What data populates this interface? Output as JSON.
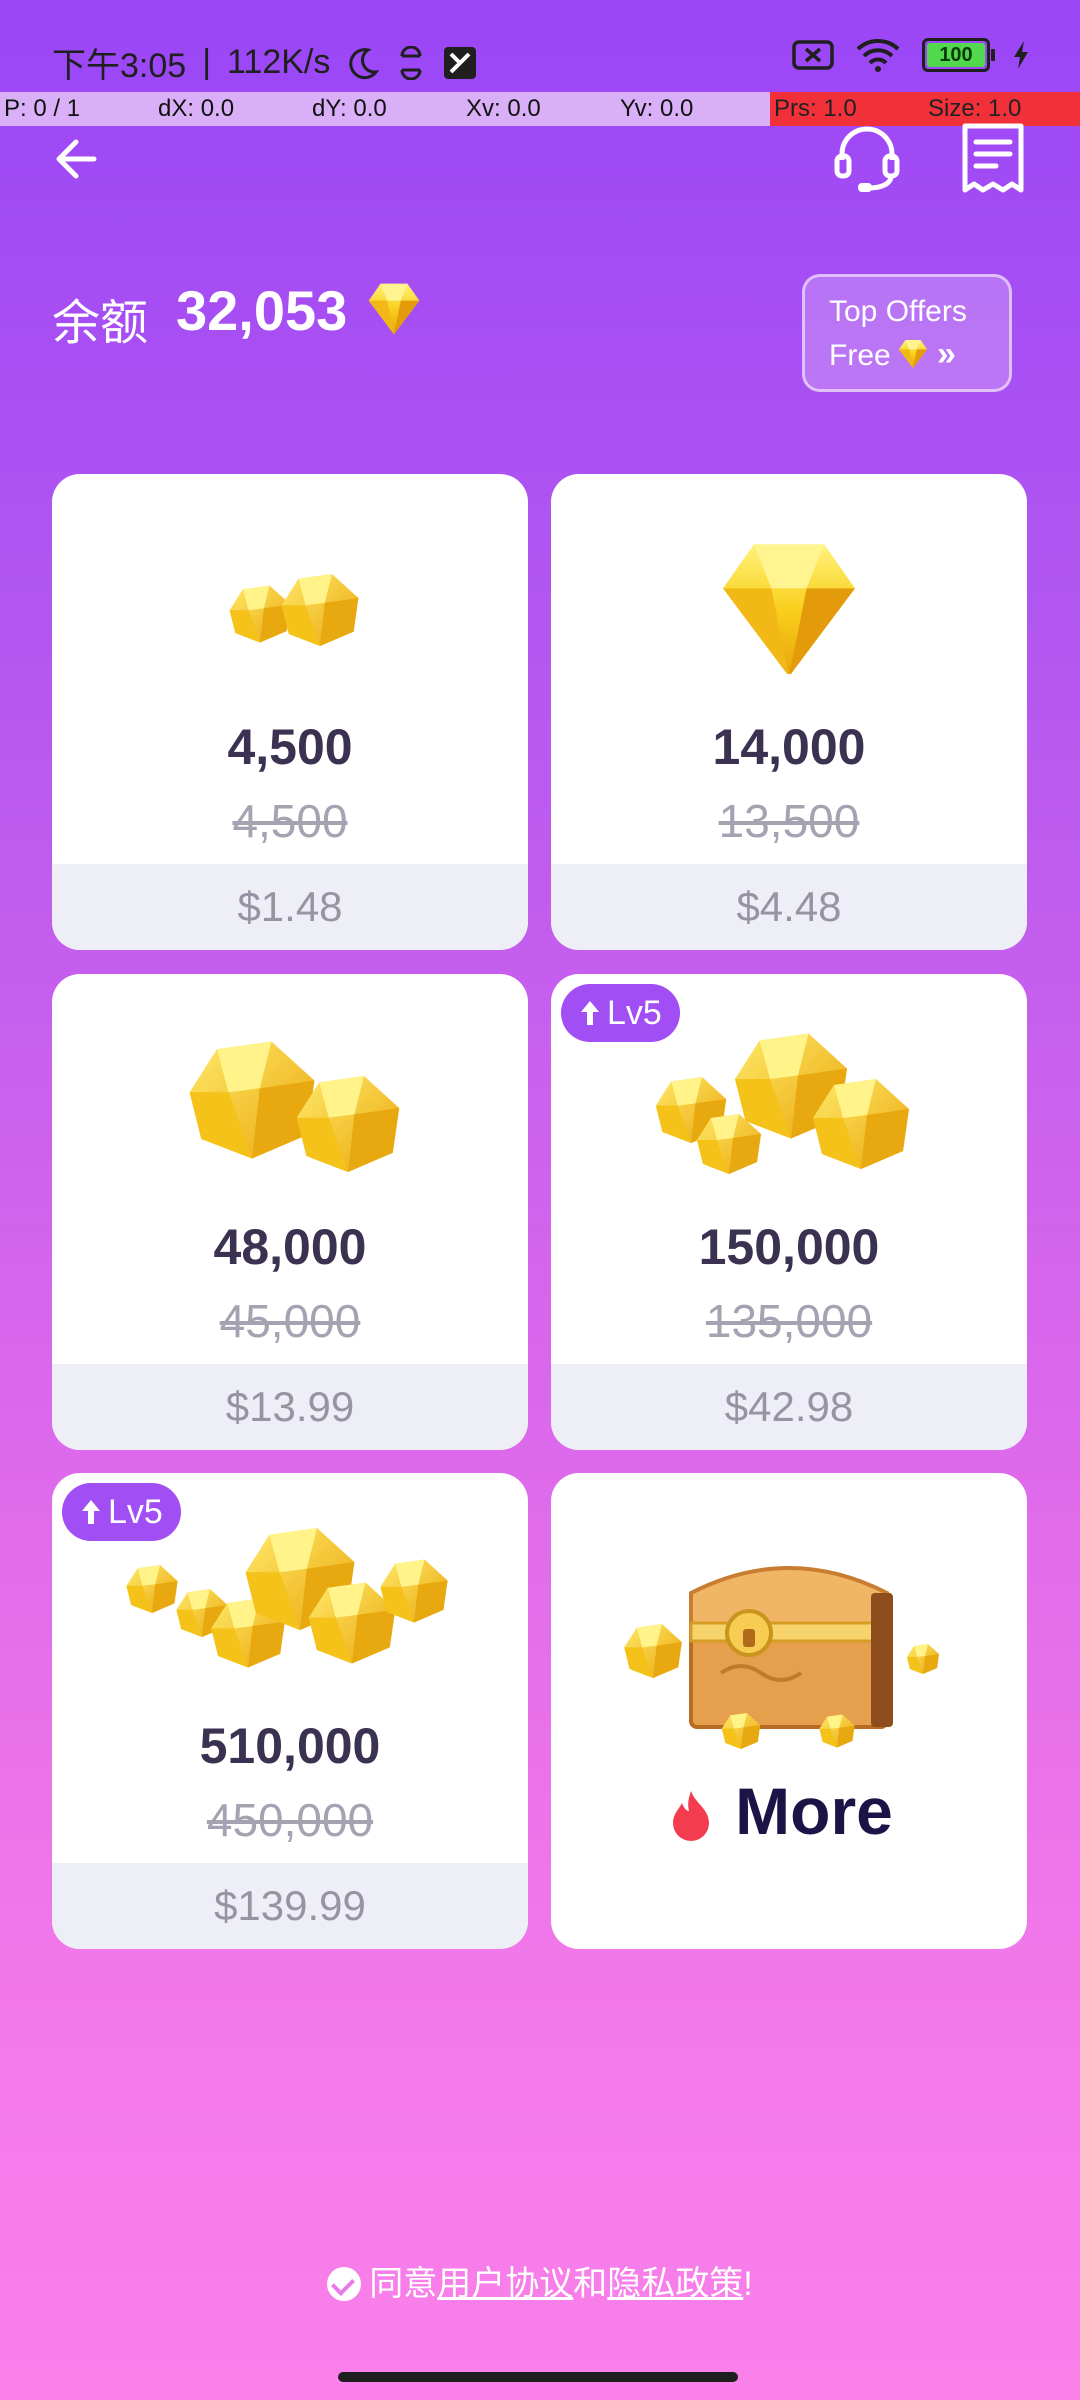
{
  "status_bar": {
    "time": "下午3:05",
    "speed": "112K/s",
    "battery": "100"
  },
  "debug": {
    "p": "P: 0 / 1",
    "dx": "dX: 0.0",
    "dy": "dY: 0.0",
    "xv": "Xv: 0.0",
    "yv": "Yv: 0.0",
    "prs": "Prs: 1.0",
    "size": "Size: 1.0"
  },
  "header": {
    "back_icon": "arrow-left-icon",
    "support_icon": "headset-icon",
    "history_icon": "receipt-icon"
  },
  "balance": {
    "label": "余额",
    "value": "32,053"
  },
  "top_offers": {
    "line1": "Top Offers",
    "line2": "Free",
    "arrows": "»"
  },
  "packages": [
    {
      "amount": "4,500",
      "original": "4,500",
      "price": "$1.48"
    },
    {
      "amount": "14,000",
      "original": "13,500",
      "price": "$4.48"
    },
    {
      "amount": "48,000",
      "original": "45,000",
      "price": "$13.99"
    },
    {
      "amount": "150,000",
      "original": "135,000",
      "price": "$42.98",
      "badge": "Lv5"
    },
    {
      "amount": "510,000",
      "original": "450,000",
      "price": "$139.99",
      "badge": "Lv5"
    }
  ],
  "more": {
    "label": "More"
  },
  "agreement": {
    "prefix": "同意",
    "user_agreement": "用户协议",
    "and": "和",
    "privacy_policy": "隐私政策",
    "suffix": "!"
  },
  "colors": {
    "accent": "#a24ef5",
    "gem": "#f7c81b"
  }
}
